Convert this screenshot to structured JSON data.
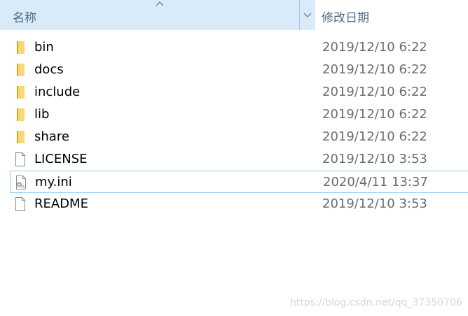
{
  "header": {
    "name_label": "名称",
    "date_label": "修改日期",
    "sort_indicator": "chevron-up-icon",
    "dropdown_indicator": "chevron-down-icon"
  },
  "files": [
    {
      "name": "bin",
      "date": "2019/12/10 6:22",
      "type": "folder",
      "icon": "folder-icon"
    },
    {
      "name": "docs",
      "date": "2019/12/10 6:22",
      "type": "folder",
      "icon": "folder-icon"
    },
    {
      "name": "include",
      "date": "2019/12/10 6:22",
      "type": "folder",
      "icon": "folder-icon"
    },
    {
      "name": "lib",
      "date": "2019/12/10 6:22",
      "type": "folder",
      "icon": "folder-icon"
    },
    {
      "name": "share",
      "date": "2019/12/10 6:22",
      "type": "folder",
      "icon": "folder-icon"
    },
    {
      "name": "LICENSE",
      "date": "2019/12/10 3:53",
      "type": "file",
      "icon": "file-icon"
    },
    {
      "name": "my.ini",
      "date": "2020/4/11 13:37",
      "type": "settings",
      "icon": "settings-file-icon",
      "selected": true
    },
    {
      "name": "README",
      "date": "2019/12/10 3:53",
      "type": "file",
      "icon": "file-icon"
    }
  ],
  "watermark": "https://blog.csdn.net/qq_37350706",
  "colors": {
    "header_bg": "#d9ebf9",
    "header_text": "#4c6a86",
    "selection_border": "#99d1ff",
    "folder": "#f8d775",
    "date_text": "#6d6d6d"
  }
}
